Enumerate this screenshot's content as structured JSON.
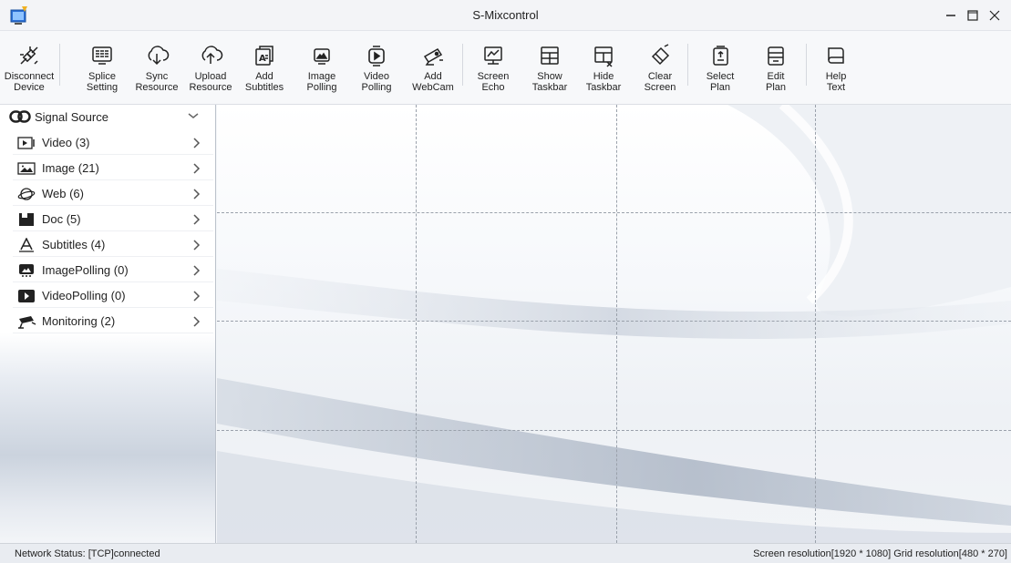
{
  "window": {
    "title": "S-Mixcontrol"
  },
  "toolbar": [
    {
      "label": "Disconnect\nDevice",
      "icon": "disconnect-device-icon"
    },
    {
      "label": "Splice\nSetting",
      "icon": "splice-setting-icon"
    },
    {
      "label": "Sync\nResource",
      "icon": "sync-resource-icon"
    },
    {
      "label": "Upload\nResource",
      "icon": "upload-resource-icon"
    },
    {
      "label": "Add\nSubtitles",
      "icon": "add-subtitles-icon"
    },
    {
      "label": "Image\nPolling",
      "icon": "image-polling-icon"
    },
    {
      "label": "Video\nPolling",
      "icon": "video-polling-icon"
    },
    {
      "label": "Add\nWebCam",
      "icon": "add-webcam-icon"
    },
    {
      "label": "Screen\nEcho",
      "icon": "screen-echo-icon"
    },
    {
      "label": "Show\nTaskbar",
      "icon": "show-taskbar-icon"
    },
    {
      "label": "Hide\nTaskbar",
      "icon": "hide-taskbar-icon"
    },
    {
      "label": "Clear\nScreen",
      "icon": "clear-screen-icon"
    },
    {
      "label": "Select\nPlan",
      "icon": "select-plan-icon"
    },
    {
      "label": "Edit\nPlan",
      "icon": "edit-plan-icon"
    },
    {
      "label": "Help\nText",
      "icon": "help-text-icon"
    }
  ],
  "sidebar": {
    "root": "Signal Source",
    "items": [
      {
        "label": "Video (3)",
        "icon": "video-icon"
      },
      {
        "label": "Image (21)",
        "icon": "image-icon"
      },
      {
        "label": "Web (6)",
        "icon": "web-icon"
      },
      {
        "label": "Doc (5)",
        "icon": "doc-icon"
      },
      {
        "label": "Subtitles (4)",
        "icon": "subtitles-icon"
      },
      {
        "label": "ImagePolling (0)",
        "icon": "image-polling-icon"
      },
      {
        "label": "VideoPolling (0)",
        "icon": "video-polling-icon"
      },
      {
        "label": "Monitoring (2)",
        "icon": "monitoring-icon"
      }
    ]
  },
  "status": {
    "network": "Network Status:  [TCP]connected",
    "resolution": "Screen resolution[1920 * 1080] Grid resolution[480 * 270]"
  },
  "colors": {
    "icon": "#222222",
    "grid": "#9aa1ab"
  }
}
